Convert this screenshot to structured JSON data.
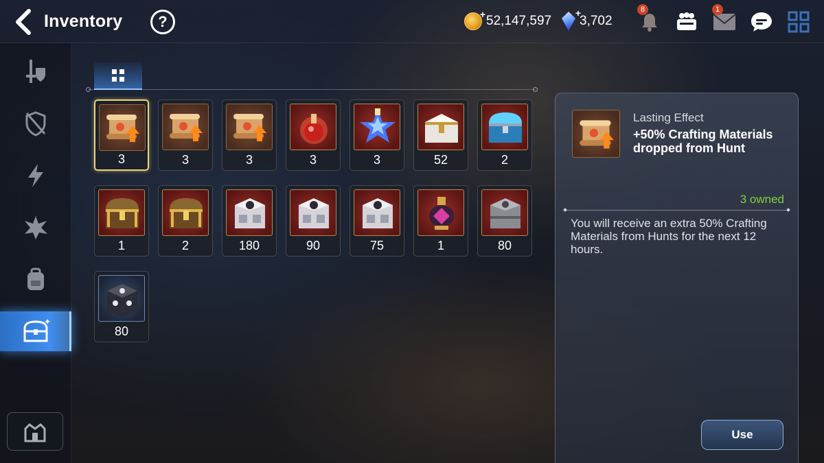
{
  "header": {
    "title": "Inventory",
    "help_icon": "question-icon",
    "gold": "52,147,597",
    "crystals": "3,702",
    "notifications_badge": "8",
    "mail_badge": "1"
  },
  "sidebar": {
    "items": [
      {
        "icon": "sword-shield-icon",
        "active": false
      },
      {
        "icon": "broken-shield-icon",
        "active": false
      },
      {
        "icon": "lightning-icon",
        "active": false
      },
      {
        "icon": "burst-icon",
        "active": false
      },
      {
        "icon": "backpack-icon",
        "active": false
      },
      {
        "icon": "treasure-chest-icon",
        "active": true
      }
    ],
    "bottom_icon": "fortress-icon"
  },
  "filter": {
    "icon": "grid-icon"
  },
  "items": [
    {
      "name": "Lasting Effect scroll (crafting)",
      "count": "3",
      "icon": "scroll-icon",
      "bg": "brown",
      "selected": true
    },
    {
      "name": "Lasting Effect scroll (rainbow)",
      "count": "3",
      "icon": "scroll-icon",
      "bg": "brown"
    },
    {
      "name": "Lasting Effect scroll",
      "count": "3",
      "icon": "scroll-icon",
      "bg": "brown"
    },
    {
      "name": "Red potion",
      "count": "3",
      "icon": "potion-icon",
      "bg": "red"
    },
    {
      "name": "Star potion",
      "count": "3",
      "icon": "star-potion-icon",
      "bg": "red"
    },
    {
      "name": "White chest",
      "count": "52",
      "icon": "white-chest-icon",
      "bg": "red"
    },
    {
      "name": "Blue chest",
      "count": "2",
      "icon": "blue-chest-icon",
      "bg": "red"
    },
    {
      "name": "Golden chest",
      "count": "1",
      "icon": "gold-chest-icon",
      "bg": "red"
    },
    {
      "name": "Golden chest",
      "count": "2",
      "icon": "gold-chest-icon",
      "bg": "red"
    },
    {
      "name": "Silver box",
      "count": "180",
      "icon": "silver-box-icon",
      "bg": "red"
    },
    {
      "name": "Silver box",
      "count": "90",
      "icon": "silver-box-icon",
      "bg": "red"
    },
    {
      "name": "Gold-trim box",
      "count": "75",
      "icon": "silver-box-icon",
      "bg": "red"
    },
    {
      "name": "Ornate lantern",
      "count": "1",
      "icon": "lantern-icon",
      "bg": "red"
    },
    {
      "name": "Steel box",
      "count": "80",
      "icon": "steel-box-icon",
      "bg": "red"
    },
    {
      "name": "Dark cube",
      "count": "80",
      "icon": "dark-cube-icon",
      "bg": "blue"
    }
  ],
  "detail": {
    "type": "Lasting Effect",
    "name": "+50% Crafting Materials dropped from Hunt",
    "owned": "3 owned",
    "description": "You will receive an extra 50% Crafting Materials from Hunts for the next 12 hours.",
    "use_label": "Use"
  },
  "colors": {
    "accent": "#3f8ef0",
    "owned": "#7ed23d",
    "selected_border": "#e9d37a"
  }
}
